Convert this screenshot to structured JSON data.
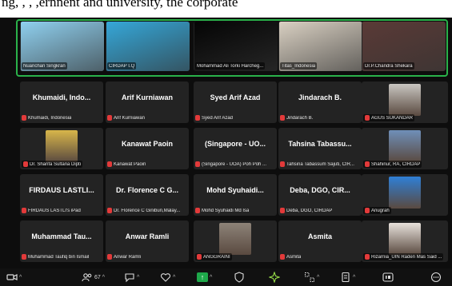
{
  "caption": {
    "text": "ng, , , ,ernnent and university, the corporate"
  },
  "meeting": {
    "speakers": [
      {
        "label": "Nuanchan Singkran",
        "bg": "#8fd0ef"
      },
      {
        "label": "CIRDAP I.Q",
        "bg": "#35a7d8"
      },
      {
        "label": "Mohammad Ali Torki Harcheg...",
        "bg": "#050505"
      },
      {
        "label": "Titas_Indonesia",
        "bg": "#d9d0c2"
      },
      {
        "label": "Dr.P.Chandra Shekara",
        "bg": "#5a3a36"
      }
    ],
    "tiles": [
      {
        "name": "Khumaidi, Indo...",
        "label": "Khumaidi, Indonesia",
        "video": false
      },
      {
        "name": "Arif Kurniawan",
        "label": "Arif Kurniawan",
        "video": false
      },
      {
        "name": "Syed Arif Azad",
        "label": "Syed Arif Azad",
        "video": false
      },
      {
        "name": "Jindarach B.",
        "label": "Jindarach B.",
        "video": false
      },
      {
        "name": "",
        "label": "AGUS SUKANDAR",
        "video": true,
        "bg": "#c9c6c1"
      },
      {
        "name": "",
        "label": "Dr. Sharifa Sultana Dipti",
        "video": true,
        "bg": "#d8b64a"
      },
      {
        "name": "Kanawat Paoin",
        "label": "Kanawat Paoin",
        "video": false
      },
      {
        "name": "(Singapore - UO...",
        "label": "(Singapore - UOA) Poh Poh ...",
        "video": false
      },
      {
        "name": "Tahsina Tabassu...",
        "label": "Tahsina Tabassum Sajuti, CIR...",
        "video": false
      },
      {
        "name": "",
        "label": "Shahinur, RA, CIRDAP",
        "video": true,
        "bg": "#6f8fb8"
      },
      {
        "name": "FIRDAUS LASTLI...",
        "label": "FIRDAUS LASTLI's iPad",
        "video": false
      },
      {
        "name": "Dr. Florence C G...",
        "label": "Dr. Florence C Ginibun,Malay...",
        "video": false
      },
      {
        "name": "Mohd Syuhaidi...",
        "label": "Mohd Syuhaidi Md Isa",
        "video": false
      },
      {
        "name": "Deba, DGO, CIR...",
        "label": "Deba, DGO, CIRDAP",
        "video": false
      },
      {
        "name": "",
        "label": "Anugrah",
        "video": true,
        "bg": "#2f7fd6"
      },
      {
        "name": "Muhammad Tau...",
        "label": "Muhammad Taufiq bin Ismail",
        "video": false
      },
      {
        "name": "Anwar Ramli",
        "label": "Anwar Ramli",
        "video": false
      },
      {
        "name": "",
        "label": "ANGGRAINI",
        "video": true,
        "bg": "#8d8378"
      },
      {
        "name": "Asmita",
        "label": "Asmita",
        "video": false
      },
      {
        "name": "",
        "label": "Rizarnia_UIN Raden Mas Said ...",
        "video": true,
        "bg": "#e8e2dc"
      }
    ]
  },
  "toolbar": {
    "participants_count": "67"
  }
}
